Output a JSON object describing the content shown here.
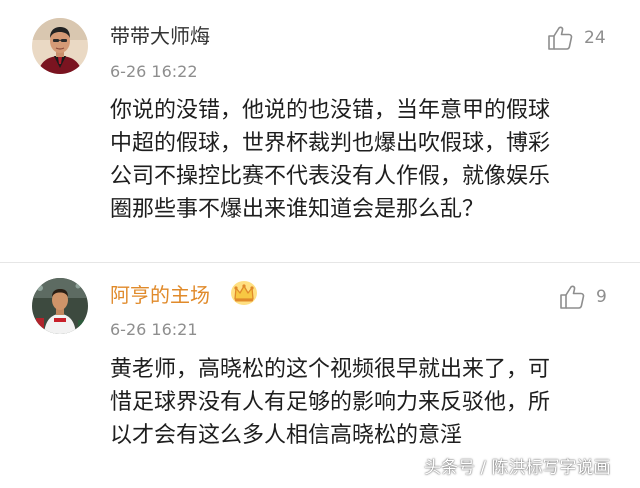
{
  "comments": [
    {
      "username": "带带大师烸",
      "timestamp": "6-26 16:22",
      "likes": "24",
      "avatar_icon": "person-portrait",
      "text": "你说的没错，他说的也没错，当年意甲的假球\n中超的假球，世界杯裁判也爆出吹假球，博彩\n公司不操控比赛不代表没有人作假，就像娱乐\n圈那些事不爆出来谁知道会是那么乱？"
    },
    {
      "username": "阿亨的主场",
      "timestamp": "6-26 16:21",
      "likes": "9",
      "avatar_icon": "football-player",
      "badge_icon": "crown-icon",
      "text": "黄老师，高晓松的这个视频很早就出来了，可\n惜足球界没有人有足够的影响力来反驳他，所\n以才会有这么多人相信高晓松的意淫"
    }
  ],
  "watermark": "头条号 / 陈洪标写字说画",
  "colors": {
    "username_default": "#333333",
    "username_vip": "#e08a2a",
    "meta_gray": "#8e8e8e",
    "body_text": "#1e1e1e",
    "separator": "#e6e6e6"
  }
}
